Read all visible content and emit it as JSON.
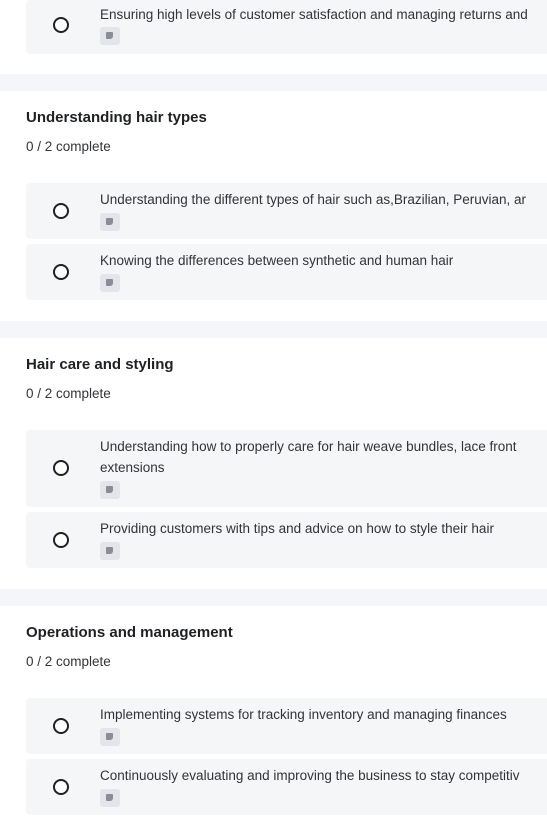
{
  "sections": [
    {
      "tasks": [
        {
          "text": "Ensuring high levels of customer satisfaction and managing returns and"
        }
      ]
    },
    {
      "title": "Understanding hair types",
      "count": "0 / 2 complete",
      "tasks": [
        {
          "text": "Understanding the different types of hair such as,Brazilian, Peruvian, ar"
        },
        {
          "text": "Knowing the differences between synthetic and human hair"
        }
      ]
    },
    {
      "title": "Hair care and styling",
      "count": "0 / 2 complete",
      "tasks": [
        {
          "text": "Understanding how to properly care for hair weave bundles, lace front extensions"
        },
        {
          "text": "Providing customers with tips and advice on how to style their hair"
        }
      ]
    },
    {
      "title": "Operations and management",
      "count": "0 / 2 complete",
      "tasks": [
        {
          "text": "Implementing systems for tracking inventory and managing finances"
        },
        {
          "text": "Continuously evaluating and improving the business to stay competitiv"
        }
      ]
    }
  ],
  "icons": {
    "checkbox": "circle-checkbox-icon",
    "note": "note-icon"
  },
  "colors": {
    "accent": "#7b8fc7",
    "background": "#f5f6f9",
    "card": "#f5f6f8"
  }
}
